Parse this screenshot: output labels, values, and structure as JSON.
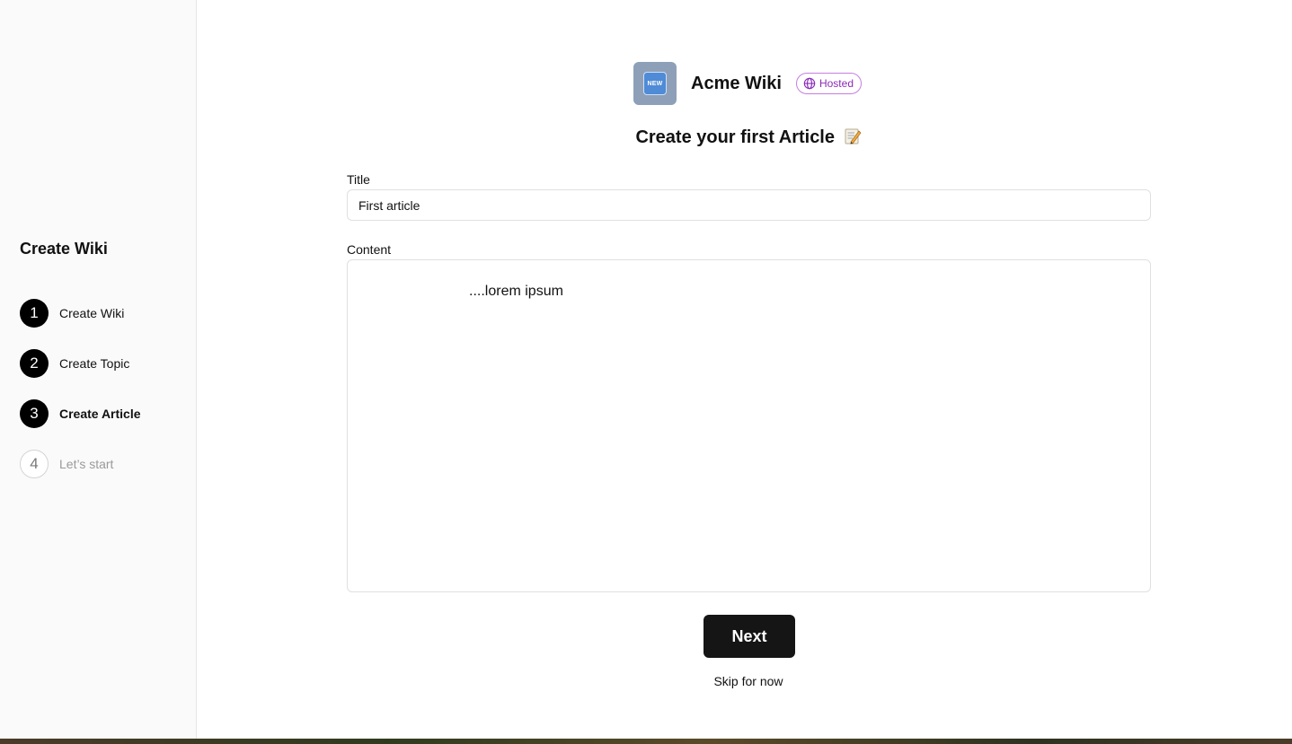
{
  "sidebar": {
    "title": "Create Wiki",
    "steps": [
      {
        "number": "1",
        "label": "Create Wiki",
        "state": "done"
      },
      {
        "number": "2",
        "label": "Create Topic",
        "state": "done"
      },
      {
        "number": "3",
        "label": "Create Article",
        "state": "active"
      },
      {
        "number": "4",
        "label": "Let’s start",
        "state": "pending"
      }
    ]
  },
  "header": {
    "logo_text": "NEW",
    "wiki_name": "Acme Wiki",
    "badge_label": "Hosted"
  },
  "form": {
    "heading": "Create your first Article",
    "title_label": "Title",
    "title_value": "First article",
    "content_label": "Content",
    "content_value": "....lorem ipsum",
    "next_label": "Next",
    "skip_label": "Skip for now"
  },
  "colors": {
    "accent": "#151515",
    "badge": "#8a2bb8",
    "logo_bg": "#8da0b8"
  },
  "icons": {
    "logo": "new-button-icon",
    "badge": "globe-icon",
    "heading": "memo-icon"
  }
}
